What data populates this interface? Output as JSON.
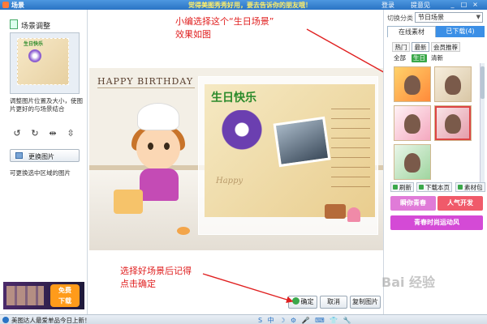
{
  "window": {
    "title": "场景",
    "promo": "觉得美图秀秀好用，要去告诉你的朋友哦！",
    "login": "登录",
    "help": "提意见",
    "controls": [
      "_",
      "□",
      "×"
    ]
  },
  "left_panel": {
    "heading": "场景调整",
    "thumb_title": "生日快乐",
    "description": "调整图片位置及大小，使图片更好的与场景结合",
    "tools": [
      "rotate-left-icon",
      "rotate-right-icon",
      "flip-horizontal-icon",
      "flip-vertical-icon"
    ],
    "replace_button": "更换图片",
    "hint": "可更换选中区域的图片",
    "ad_badge_line1": "免费",
    "ad_badge_line2": "下载"
  },
  "annotations": {
    "top_line1": "小编选择这个“生日场景”",
    "top_line2": "效果如图",
    "bottom_line1": "选择好场景后记得",
    "bottom_line2": "点击确定"
  },
  "canvas": {
    "banner_text": "HAPPY BIRTHDAY",
    "card_title": "生日快乐",
    "card_script": "Happy"
  },
  "bottom_buttons": {
    "ok": "确定",
    "cancel": "取消",
    "reset": "复制图片"
  },
  "right_panel": {
    "category_label": "切换分类",
    "category_value": "节日场景",
    "tabs": [
      "在线素材",
      "已下载(4)"
    ],
    "subtabs": [
      "热门",
      "最新",
      "会员推荐"
    ],
    "filters": [
      "全部",
      "生日",
      "清新"
    ],
    "actions": [
      "刷新",
      "下载本页",
      "素材包"
    ],
    "tags": [
      "瞬你青春",
      "人气开发",
      "青春时尚运动风"
    ],
    "tag_colors": [
      "#e07bd8",
      "#f05a6a",
      "#d44ad6"
    ]
  },
  "status": {
    "text": "美图达人最爱单品今日上新！",
    "tray": "S 中 ☽ ⚙ 🎤 ⌨ 👕 🔧"
  },
  "watermark": "Bai 经验"
}
